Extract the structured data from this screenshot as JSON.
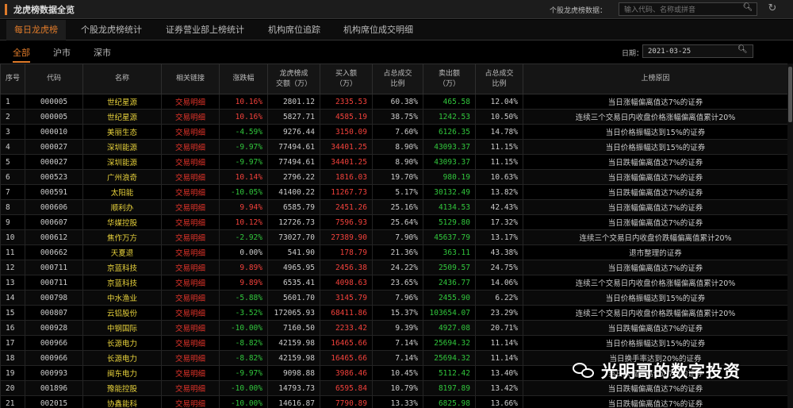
{
  "app": {
    "title": "龙虎榜数据全览"
  },
  "search": {
    "label": "个股龙虎榜数据：",
    "placeholder": "输入代码、名称或拼音"
  },
  "tabs": [
    {
      "label": "每日龙虎榜",
      "active": true
    },
    {
      "label": "个股龙虎榜统计",
      "active": false
    },
    {
      "label": "证券营业部上榜统计",
      "active": false
    },
    {
      "label": "机构席位追踪",
      "active": false
    },
    {
      "label": "机构席位成交明细",
      "active": false
    }
  ],
  "subtabs": [
    {
      "label": "全部",
      "active": true
    },
    {
      "label": "沪市",
      "active": false
    },
    {
      "label": "深市",
      "active": false
    }
  ],
  "date": {
    "label": "日期：",
    "value": "2021-03-25"
  },
  "columns": [
    "序号",
    "代码",
    "名称",
    "相关链接",
    "涨跌幅",
    "龙虎榜成\n交额（万）",
    "买入额\n（万）",
    "占总成交\n比例",
    "卖出额\n（万）",
    "占总成交\n比例",
    "上榜原因"
  ],
  "rows": [
    {
      "idx": "1",
      "code": "000005",
      "name": "世纪星源",
      "link": "交易明细",
      "chg": "10.16%",
      "dir": "up",
      "amt": "2801.12",
      "buy": "2335.53",
      "buy_pct": "60.38%",
      "sell": "465.58",
      "sell_pct": "12.04%",
      "reason": "当日涨幅偏离值达7%的证券"
    },
    {
      "idx": "2",
      "code": "000005",
      "name": "世纪星源",
      "link": "交易明细",
      "chg": "10.16%",
      "dir": "up",
      "amt": "5827.71",
      "buy": "4585.19",
      "buy_pct": "38.75%",
      "sell": "1242.53",
      "sell_pct": "10.50%",
      "reason": "连续三个交易日内收盘价格涨幅偏离值累计20%"
    },
    {
      "idx": "3",
      "code": "000010",
      "name": "美丽生态",
      "link": "交易明细",
      "chg": "-4.59%",
      "dir": "down",
      "amt": "9276.44",
      "buy": "3150.09",
      "buy_pct": "7.60%",
      "sell": "6126.35",
      "sell_pct": "14.78%",
      "reason": "当日价格振幅达到15%的证券"
    },
    {
      "idx": "4",
      "code": "000027",
      "name": "深圳能源",
      "link": "交易明细",
      "chg": "-9.97%",
      "dir": "down",
      "amt": "77494.61",
      "buy": "34401.25",
      "buy_pct": "8.90%",
      "sell": "43093.37",
      "sell_pct": "11.15%",
      "reason": "当日价格振幅达到15%的证券"
    },
    {
      "idx": "5",
      "code": "000027",
      "name": "深圳能源",
      "link": "交易明细",
      "chg": "-9.97%",
      "dir": "down",
      "amt": "77494.61",
      "buy": "34401.25",
      "buy_pct": "8.90%",
      "sell": "43093.37",
      "sell_pct": "11.15%",
      "reason": "当日跌幅偏离值达7%的证券"
    },
    {
      "idx": "6",
      "code": "000523",
      "name": "广州浪奇",
      "link": "交易明细",
      "chg": "10.14%",
      "dir": "up",
      "amt": "2796.22",
      "buy": "1816.03",
      "buy_pct": "19.70%",
      "sell": "980.19",
      "sell_pct": "10.63%",
      "reason": "当日涨幅偏离值达7%的证券"
    },
    {
      "idx": "7",
      "code": "000591",
      "name": "太阳能",
      "link": "交易明细",
      "chg": "-10.05%",
      "dir": "down",
      "amt": "41400.22",
      "buy": "11267.73",
      "buy_pct": "5.17%",
      "sell": "30132.49",
      "sell_pct": "13.82%",
      "reason": "当日跌幅偏离值达7%的证券"
    },
    {
      "idx": "8",
      "code": "000606",
      "name": "顺利办",
      "link": "交易明细",
      "chg": "9.94%",
      "dir": "up",
      "amt": "6585.79",
      "buy": "2451.26",
      "buy_pct": "25.16%",
      "sell": "4134.53",
      "sell_pct": "42.43%",
      "reason": "当日涨幅偏离值达7%的证券"
    },
    {
      "idx": "9",
      "code": "000607",
      "name": "华媒控股",
      "link": "交易明细",
      "chg": "10.12%",
      "dir": "up",
      "amt": "12726.73",
      "buy": "7596.93",
      "buy_pct": "25.64%",
      "sell": "5129.80",
      "sell_pct": "17.32%",
      "reason": "当日涨幅偏离值达7%的证券"
    },
    {
      "idx": "10",
      "code": "000612",
      "name": "焦作万方",
      "link": "交易明细",
      "chg": "-2.92%",
      "dir": "down",
      "amt": "73027.70",
      "buy": "27389.90",
      "buy_pct": "7.90%",
      "sell": "45637.79",
      "sell_pct": "13.17%",
      "reason": "连续三个交易日内收盘价跌幅偏离值累计20%"
    },
    {
      "idx": "11",
      "code": "000662",
      "name": "天夏退",
      "link": "交易明细",
      "chg": "0.00%",
      "dir": "flat",
      "amt": "541.90",
      "buy": "178.79",
      "buy_pct": "21.36%",
      "sell": "363.11",
      "sell_pct": "43.38%",
      "reason": "退市整理的证券"
    },
    {
      "idx": "12",
      "code": "000711",
      "name": "京蓝科技",
      "link": "交易明细",
      "chg": "9.89%",
      "dir": "up",
      "amt": "4965.95",
      "buy": "2456.38",
      "buy_pct": "24.22%",
      "sell": "2509.57",
      "sell_pct": "24.75%",
      "reason": "当日涨幅偏离值达7%的证券"
    },
    {
      "idx": "13",
      "code": "000711",
      "name": "京蓝科技",
      "link": "交易明细",
      "chg": "9.89%",
      "dir": "up",
      "amt": "6535.41",
      "buy": "4098.63",
      "buy_pct": "23.65%",
      "sell": "2436.77",
      "sell_pct": "14.06%",
      "reason": "连续三个交易日内收盘价格涨幅偏离值累计20%"
    },
    {
      "idx": "14",
      "code": "000798",
      "name": "中水渔业",
      "link": "交易明细",
      "chg": "-5.88%",
      "dir": "down",
      "amt": "5601.70",
      "buy": "3145.79",
      "buy_pct": "7.96%",
      "sell": "2455.90",
      "sell_pct": "6.22%",
      "reason": "当日价格振幅达到15%的证券"
    },
    {
      "idx": "15",
      "code": "000807",
      "name": "云铝股份",
      "link": "交易明细",
      "chg": "-3.52%",
      "dir": "down",
      "amt": "172065.93",
      "buy": "68411.86",
      "buy_pct": "15.37%",
      "sell": "103654.07",
      "sell_pct": "23.29%",
      "reason": "连续三个交易日内收盘价格跌幅偏离值累计20%"
    },
    {
      "idx": "16",
      "code": "000928",
      "name": "中钢国际",
      "link": "交易明细",
      "chg": "-10.00%",
      "dir": "down",
      "amt": "7160.50",
      "buy": "2233.42",
      "buy_pct": "9.39%",
      "sell": "4927.08",
      "sell_pct": "20.71%",
      "reason": "当日跌幅偏离值达7%的证券"
    },
    {
      "idx": "17",
      "code": "000966",
      "name": "长源电力",
      "link": "交易明细",
      "chg": "-8.82%",
      "dir": "down",
      "amt": "42159.98",
      "buy": "16465.66",
      "buy_pct": "7.14%",
      "sell": "25694.32",
      "sell_pct": "11.14%",
      "reason": "当日价格振幅达到15%的证券"
    },
    {
      "idx": "18",
      "code": "000966",
      "name": "长源电力",
      "link": "交易明细",
      "chg": "-8.82%",
      "dir": "down",
      "amt": "42159.98",
      "buy": "16465.66",
      "buy_pct": "7.14%",
      "sell": "25694.32",
      "sell_pct": "11.14%",
      "reason": "当日换手率达到20%的证券"
    },
    {
      "idx": "19",
      "code": "000993",
      "name": "闽东电力",
      "link": "交易明细",
      "chg": "-9.97%",
      "dir": "down",
      "amt": "9098.88",
      "buy": "3986.46",
      "buy_pct": "10.45%",
      "sell": "5112.42",
      "sell_pct": "13.40%",
      "reason": "当日跌幅偏离值达7%的证券"
    },
    {
      "idx": "20",
      "code": "001896",
      "name": "豫能控股",
      "link": "交易明细",
      "chg": "-10.00%",
      "dir": "down",
      "amt": "14793.73",
      "buy": "6595.84",
      "buy_pct": "10.79%",
      "sell": "8197.89",
      "sell_pct": "13.42%",
      "reason": "当日跌幅偏离值达7%的证券"
    },
    {
      "idx": "21",
      "code": "002015",
      "name": "协鑫能科",
      "link": "交易明细",
      "chg": "-10.00%",
      "dir": "down",
      "amt": "14616.87",
      "buy": "7790.89",
      "buy_pct": "13.33%",
      "sell": "6825.98",
      "sell_pct": "13.66%",
      "reason": "当日跌幅偏离值达7%的证券"
    }
  ],
  "watermark": {
    "text": "光明哥的数字投资"
  },
  "colors": {
    "accent": "#e07b2a",
    "up": "#f2413b",
    "down": "#31c63c",
    "name": "#e8d23c"
  },
  "icons": {
    "search": "search-icon",
    "refresh": "refresh-icon",
    "wechat": "wechat-icon"
  }
}
